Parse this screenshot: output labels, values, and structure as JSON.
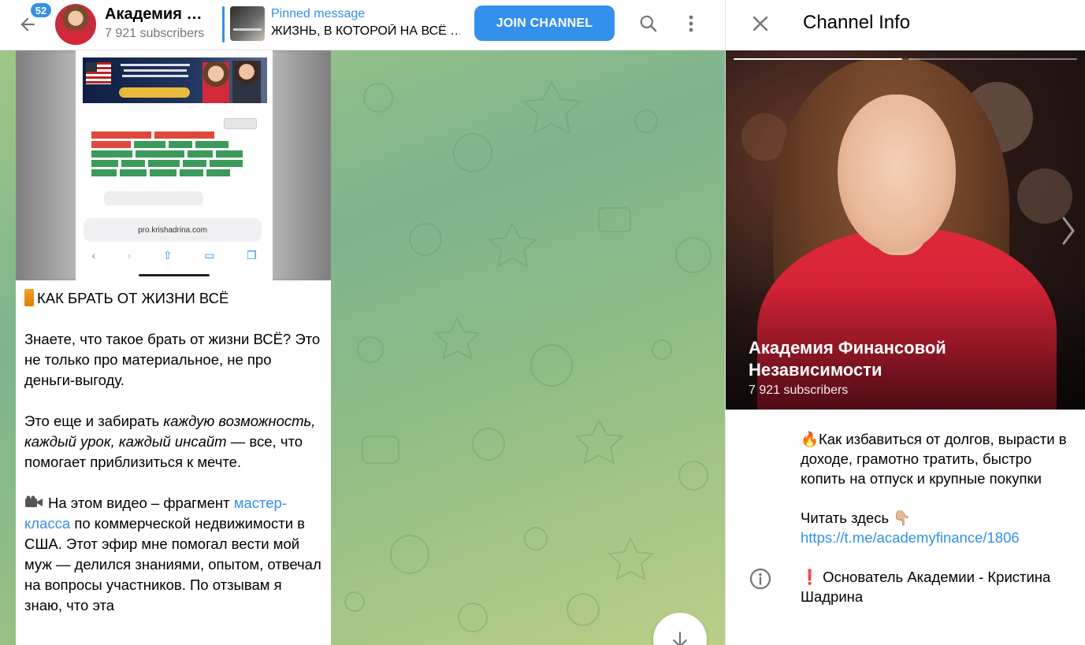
{
  "header": {
    "badge": "52",
    "title": "Академия …",
    "subscribers": "7 921 subscribers",
    "pinned_label": "Pinned message",
    "pinned_text": "ЖИЗНЬ, В КОТОРОЙ НА ВСЁ …",
    "join_label": "JOIN CHANNEL"
  },
  "message": {
    "url": "pro.krishadrina.com",
    "heading": "КАК БРАТЬ ОТ ЖИЗНИ ВСЁ",
    "p1": "Знаете, что такое брать от жизни ВСЁ? Это не только про материальное, не про деньги-выгоду.",
    "p2_start": "Это еще и забирать ",
    "p2_em": "каждую возможность, каждый урок, каждый инсайт",
    "p2_end": " — все, что помогает приблизиться к мечте.",
    "p3_start": "На этом видео – фрагмент ",
    "p3_link": "мастер-класса",
    "p3_end": " по коммерческой недвижимости в США. Этот эфир мне помогал вести мой муж — делился знаниями, опытом, отвечал на вопросы участников. По отзывам я знаю, что эта"
  },
  "info": {
    "title": "Channel Info",
    "name": "Академия Финансовой Независимости",
    "subscribers": "7 921 subscribers",
    "desc1": "🔥Как избавиться от долгов, вырасти в доходе, грамотно тратить, быстро копить на отпуск и крупные покупки",
    "desc2_label": "Читать здесь 👇🏼",
    "desc2_link": "https://t.me/academyfinance/1806",
    "desc3": "❗ Основатель Академии - Кристина Шадрина"
  },
  "colors": {
    "accent": "#3390ec",
    "chat_bg": "#8fbc86"
  }
}
